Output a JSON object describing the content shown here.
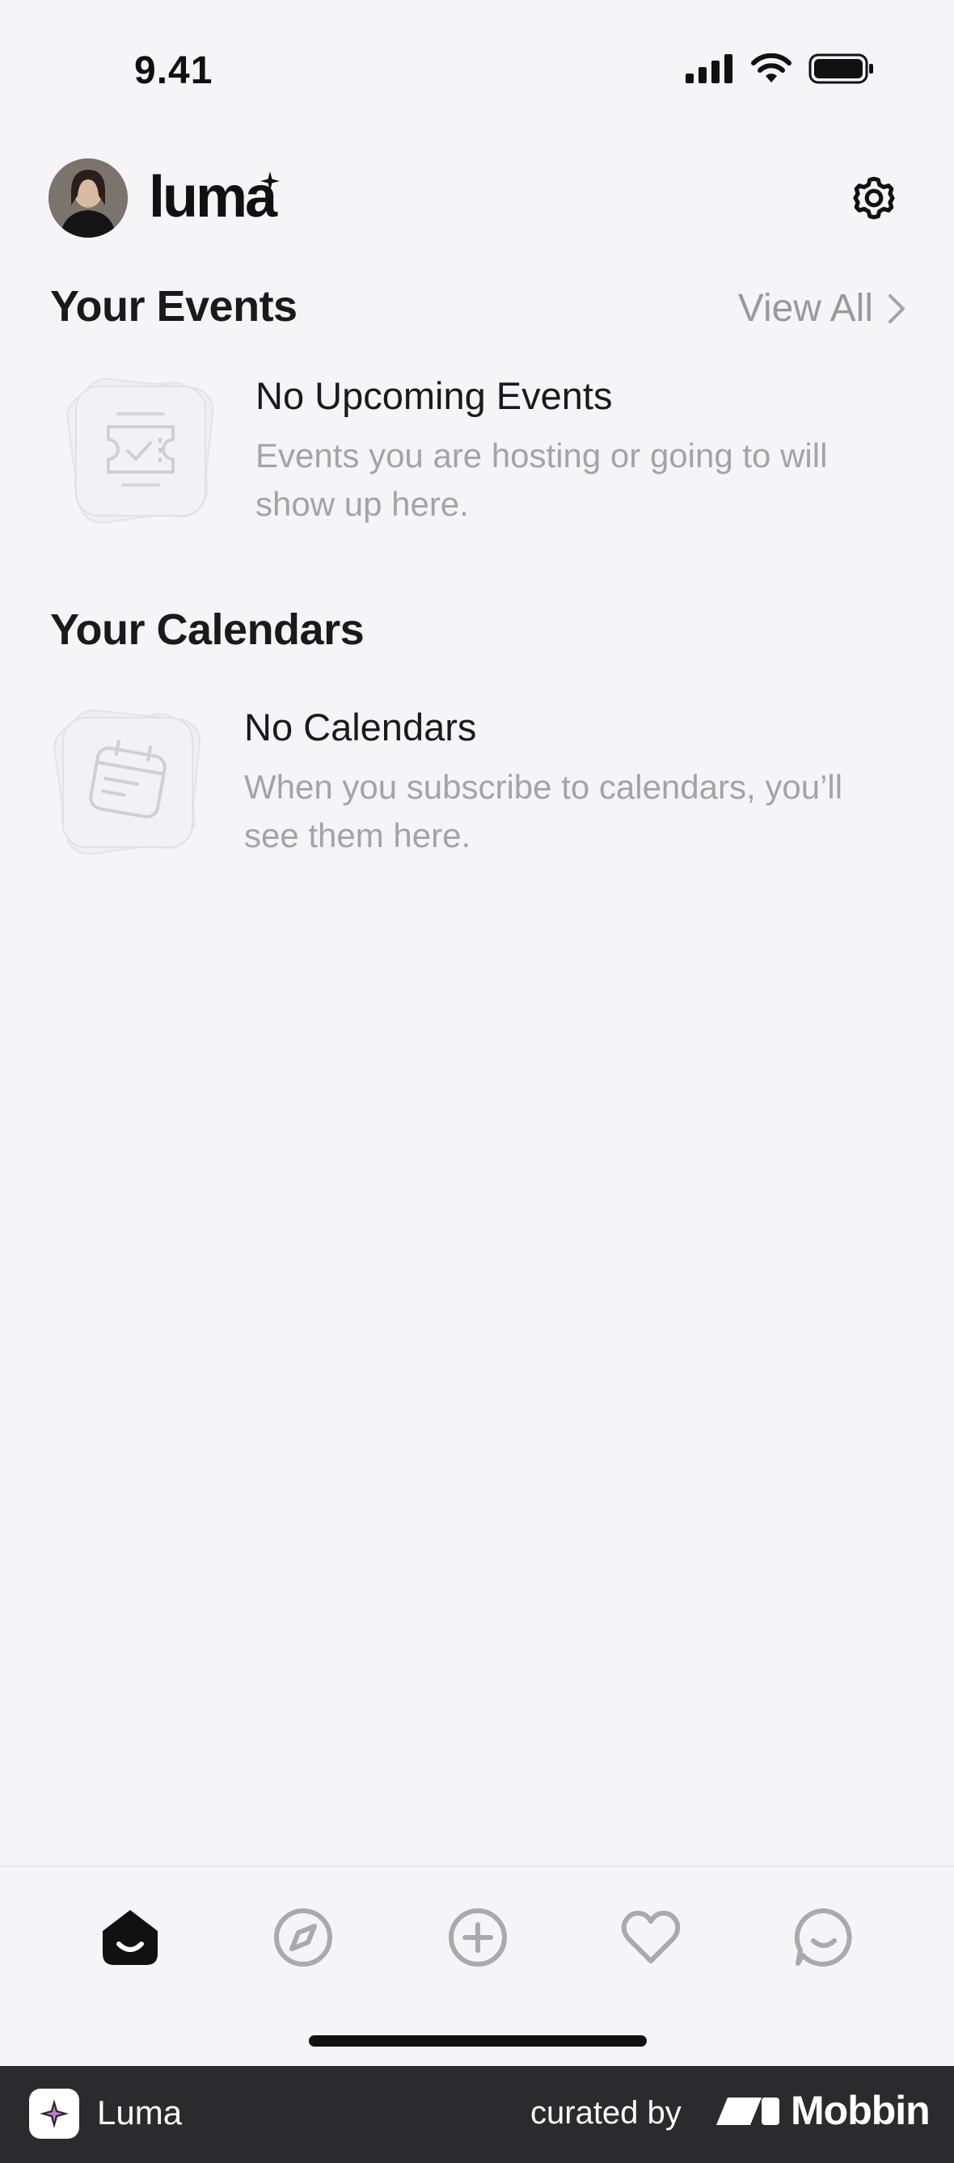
{
  "status_bar": {
    "time": "9.41"
  },
  "header": {
    "logo": "luma"
  },
  "events": {
    "title": "Your Events",
    "view_all": "View All",
    "empty_title": "No Upcoming Events",
    "empty_line1": "Events you are hosting or going to will",
    "empty_line2": "show up here."
  },
  "calendars": {
    "title": "Your Calendars",
    "empty_title": "No Calendars",
    "empty_line1": "When you subscribe to calendars, you’ll",
    "empty_line2": "see them here."
  },
  "tabbar": {
    "tabs": [
      "home-icon",
      "compass-icon",
      "plus-circle-icon",
      "heart-icon",
      "chat-icon"
    ],
    "active": "home-icon"
  },
  "footer": {
    "app_name": "Luma",
    "curated_by": "curated by",
    "brand": "Mobbin"
  },
  "colors": {
    "background": "#f5f5f7",
    "text": "#1a1a1a",
    "muted": "#a4a4a8",
    "footer": "#2b2b2d"
  }
}
